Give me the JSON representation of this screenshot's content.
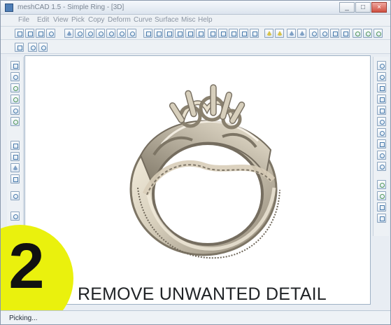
{
  "window": {
    "title": "meshCAD 1.5 - Simple Ring - [3D]"
  },
  "menubar": {
    "items": [
      "File",
      "Edit",
      "View",
      "Pick",
      "Copy",
      "Deform",
      "Curve",
      "Surface",
      "Misc",
      "Help"
    ]
  },
  "toolbar": {
    "row1_icons": [
      "new-icon",
      "open-icon",
      "save-icon",
      "help-icon",
      "move-icon",
      "circle-icon",
      "circle-icon",
      "circle-icon",
      "circle-icon",
      "circle-icon",
      "circle-icon",
      "square-icon",
      "square-icon",
      "square-icon",
      "square-icon",
      "square-icon",
      "square-icon",
      "square-icon",
      "square-icon",
      "square-icon",
      "square-icon",
      "square-icon",
      "square-icon",
      "triangle-icon",
      "triangle-icon",
      "triangle-icon",
      "triangle-icon",
      "triangle-icon",
      "square-icon",
      "square-icon",
      "square-icon",
      "square-icon",
      "square-icon",
      "square-icon",
      "square-icon",
      "triangle-icon",
      "triangle-icon"
    ],
    "row2_icons": [
      "select-icon",
      "undo-icon",
      "redo-icon"
    ]
  },
  "side_tools": {
    "left_count": 13,
    "right_count": 16
  },
  "overlay": {
    "step_number": "2",
    "caption": "REMOVE UNWANTED DETAIL"
  },
  "status": {
    "text": "Picking..."
  },
  "colors": {
    "accent_yellow": "#eaf10d",
    "ring_metal": "#d8d0bd",
    "ring_shadow": "#7d7565"
  }
}
